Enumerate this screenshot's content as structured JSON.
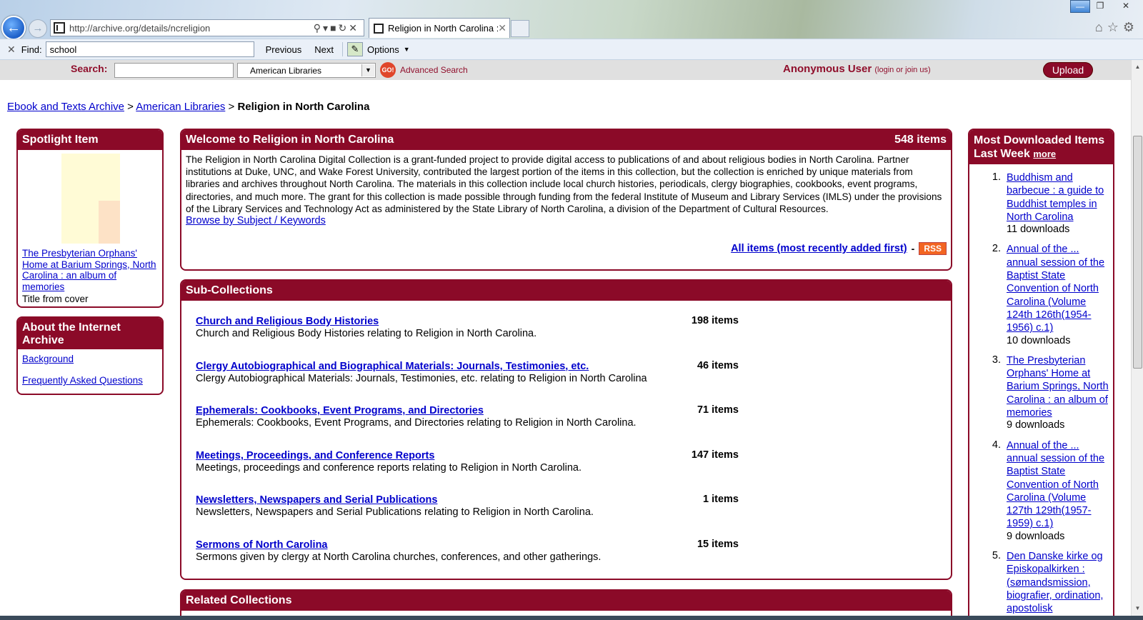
{
  "browser": {
    "url": "http://archive.org/details/ncreligion",
    "tab_title": "Religion in North Carolina : ...",
    "find_label": "Find:",
    "find_value": "school",
    "find_previous": "Previous",
    "find_next": "Next",
    "find_options": "Options"
  },
  "sitebar": {
    "search_label": "Search:",
    "collection_select": "American Libraries",
    "go_label": "GO!",
    "advanced_search": "Advanced Search",
    "user": "Anonymous User",
    "login_text": "(login or join us)",
    "upload": "Upload"
  },
  "breadcrumb": {
    "items": [
      "Ebook and Texts Archive",
      "American Libraries"
    ],
    "separator": ">",
    "current": "Religion in North Carolina"
  },
  "spotlight": {
    "heading": "Spotlight Item",
    "title": "The Presbyterian Orphans' Home at Barium Springs, North Carolina : an album of memories",
    "description": "Title from cover"
  },
  "about": {
    "heading": "About the Internet Archive",
    "links": [
      "Background",
      "Frequently Asked Questions"
    ]
  },
  "welcome": {
    "heading": "Welcome to Religion in North Carolina",
    "count": "548 items",
    "body": "The Religion in North Carolina Digital Collection is a grant-funded project to provide digital access to publications of and about religious bodies in North Carolina. Partner institutions at Duke, UNC, and Wake Forest University, contributed the largest portion of the items in this collection, but the collection is enriched by unique materials from libraries and archives throughout North Carolina. The materials in this collection include local church histories, periodicals, clergy biographies, cookbooks, event programs, directories, and much more. The grant for this collection is made possible through funding from the federal Institute of Museum and Library Services (IMLS) under the provisions of the Library Services and Technology Act as administered by the State Library of North Carolina, a division of the Department of Cultural Resources.",
    "browse_link": "Browse by Subject / Keywords",
    "all_items_link": "All items (most recently added first)",
    "dash": "-",
    "rss": "RSS"
  },
  "subcollections": {
    "heading": "Sub-Collections",
    "items": [
      {
        "title": "Church and Religious Body Histories",
        "count": "198 items",
        "desc": "Church and Religious Body Histories relating to Religion in North Carolina."
      },
      {
        "title": "Clergy Autobiographical and Biographical Materials: Journals, Testimonies, etc.",
        "count": "46 items",
        "desc": "Clergy Autobiographical Materials: Journals, Testimonies, etc. relating to Religion in North Carolina"
      },
      {
        "title": "Ephemerals: Cookbooks, Event Programs, and Directories",
        "count": "71 items",
        "desc": "Ephemerals: Cookbooks, Event Programs, and Directories relating to Religion in North Carolina."
      },
      {
        "title": "Meetings, Proceedings, and Conference Reports",
        "count": "147 items",
        "desc": "Meetings, proceedings and conference reports relating to Religion in North Carolina."
      },
      {
        "title": "Newsletters, Newspapers and Serial Publications",
        "count": "1 items",
        "desc": "Newsletters, Newspapers and Serial Publications relating to Religion in North Carolina."
      },
      {
        "title": "Sermons of North Carolina",
        "count": "15 items",
        "desc": "Sermons given by clergy at North Carolina churches, conferences, and other gatherings."
      }
    ]
  },
  "related": {
    "heading": "Related Collections"
  },
  "most_downloaded": {
    "heading": "Most Downloaded Items Last Week",
    "more": "more",
    "items": [
      {
        "num": "1.",
        "title": "Buddhism and barbecue : a guide to Buddhist temples in North Carolina",
        "downloads": "11 downloads"
      },
      {
        "num": "2.",
        "title": "Annual of the ... annual session of the Baptist State Convention of North Carolina (Volume 124th 126th(1954-1956) c.1)",
        "downloads": "10 downloads"
      },
      {
        "num": "3.",
        "title": "The Presbyterian Orphans' Home at Barium Springs, North Carolina : an album of memories",
        "downloads": "9 downloads"
      },
      {
        "num": "4.",
        "title": "Annual of the ... annual session of the Baptist State Convention of North Carolina (Volume 127th 129th(1957-1959) c.1)",
        "downloads": "9 downloads"
      },
      {
        "num": "5.",
        "title": "Den Danske kirke og Episkopalkirken : (sømandsmission, biografier, ordination, apostolisk succession) :",
        "downloads": ""
      }
    ]
  }
}
